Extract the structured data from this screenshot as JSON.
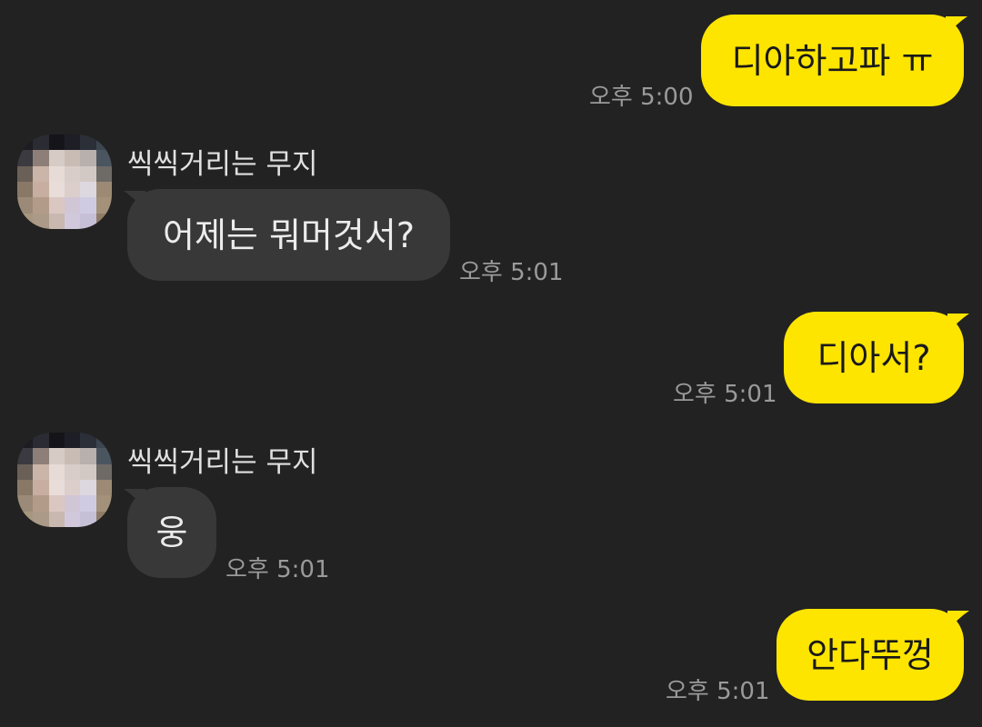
{
  "theme": {
    "background": "#222222",
    "my_bubble_color": "#FEE500",
    "their_bubble_color": "#383838",
    "time_color": "#9A9A9A"
  },
  "messages": [
    {
      "side": "mine",
      "text": "디아하고파 ㅠ",
      "time": "오후 5:00"
    },
    {
      "side": "theirs",
      "sender": "씩씩거리는 무지",
      "avatar": "blurred-profile-avatar",
      "text": "어제는 뭐머것서?",
      "time": "오후 5:01"
    },
    {
      "side": "mine",
      "text": "디아서?",
      "time": "오후 5:01"
    },
    {
      "side": "theirs",
      "sender": "씩씩거리는 무지",
      "avatar": "blurred-profile-avatar",
      "text": "웅",
      "time": "오후 5:01"
    },
    {
      "side": "mine",
      "text": "안다뚜껑",
      "time": "오후 5:01"
    }
  ]
}
